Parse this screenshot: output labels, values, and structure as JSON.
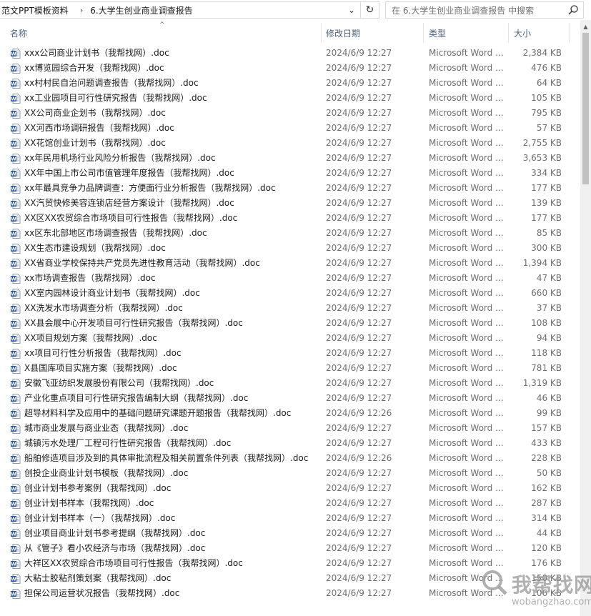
{
  "address": {
    "crumbs": [
      "范文PPT模板资料",
      "6.大学生创业商业调查报告"
    ],
    "separator": "›",
    "dropdown": "⌄",
    "refresh": "↻"
  },
  "search": {
    "placeholder": "在 6.大学生创业商业调查报告 中搜索"
  },
  "columns": {
    "name": "名称",
    "date": "修改日期",
    "type": "类型",
    "size": "大小",
    "sort_indicator": "^"
  },
  "scrollbar": {
    "up_arrow": "▲"
  },
  "watermark": {
    "text": "我帮找网",
    "url": "wobangzhao.com"
  },
  "icons": {
    "file": "word-doc-icon",
    "search": "search-icon"
  },
  "colors": {
    "header_text": "#4c607a",
    "word_blue": "#2b579a"
  },
  "files": [
    {
      "name": "xxx公司商业计划书（我帮找网）.doc",
      "date": "2024/6/9 12:27",
      "type": "Microsoft Word ...",
      "size": "2,384 KB"
    },
    {
      "name": "xx博览园综合开发（我帮找网）.doc",
      "date": "2024/6/9 12:27",
      "type": "Microsoft Word ...",
      "size": "476 KB"
    },
    {
      "name": "xx村村民自治问题调查报告（我帮找网）.doc",
      "date": "2024/6/9 12:27",
      "type": "Microsoft Word ...",
      "size": "64 KB"
    },
    {
      "name": "xx工业园项目可行性研究报告（我帮找网）.doc",
      "date": "2024/6/9 12:27",
      "type": "Microsoft Word ...",
      "size": "105 KB"
    },
    {
      "name": "XX公司商业企划书（我帮找网）.doc",
      "date": "2024/6/9 12:27",
      "type": "Microsoft Word ...",
      "size": "795 KB"
    },
    {
      "name": "XX河西市场调研报告（我帮找网）.doc",
      "date": "2024/6/9 12:27",
      "type": "Microsoft Word ...",
      "size": "57 KB"
    },
    {
      "name": "XX花馆创业计划书（我帮找网）.doc",
      "date": "2024/6/9 12:27",
      "type": "Microsoft Word ...",
      "size": "2,755 KB"
    },
    {
      "name": "xx年民用机场行业风险分析报告（我帮找网）.doc",
      "date": "2024/6/9 12:27",
      "type": "Microsoft Word ...",
      "size": "3,653 KB"
    },
    {
      "name": "XX年中国上市公司市值管理年度报告（我帮找网）.doc",
      "date": "2024/6/9 12:27",
      "type": "Microsoft Word ...",
      "size": "334 KB"
    },
    {
      "name": "xx年最具竞争力品牌调查：方便面行业分析报告（我帮找网）.doc",
      "date": "2024/6/9 12:27",
      "type": "Microsoft Word ...",
      "size": "177 KB"
    },
    {
      "name": "XX汽贸快修美容连锁店经营方案设计（我帮找网）.doc",
      "date": "2024/6/9 12:27",
      "type": "Microsoft Word ...",
      "size": "139 KB"
    },
    {
      "name": "XX区XX农贸综合市场项目可行性报告（我帮找网）.doc",
      "date": "2024/6/9 12:27",
      "type": "Microsoft Word ...",
      "size": "177 KB"
    },
    {
      "name": "xx区东北部地区市场调查报告（我帮找网）.doc",
      "date": "2024/6/9 12:27",
      "type": "Microsoft Word ...",
      "size": "85 KB"
    },
    {
      "name": "XX生态市建设规划（我帮找网）.doc",
      "date": "2024/6/9 12:27",
      "type": "Microsoft Word ...",
      "size": "300 KB"
    },
    {
      "name": "XX省商业学校保持共产党员先进性教育活动（我帮找网）.doc",
      "date": "2024/6/9 12:27",
      "type": "Microsoft Word ...",
      "size": "1,394 KB"
    },
    {
      "name": "xx市场调查报告（我帮找网）.doc",
      "date": "2024/6/9 12:27",
      "type": "Microsoft Word ...",
      "size": "47 KB"
    },
    {
      "name": "XX室内园林设计商业计划书（我帮找网）.doc",
      "date": "2024/6/9 12:27",
      "type": "Microsoft Word ...",
      "size": "660 KB"
    },
    {
      "name": "XX洗发水市场调查分析（我帮找网）.doc",
      "date": "2024/6/9 12:27",
      "type": "Microsoft Word ...",
      "size": "37 KB"
    },
    {
      "name": "XX县会展中心开发项目可行性研究报告（我帮找网）.doc",
      "date": "2024/6/9 12:27",
      "type": "Microsoft Word ...",
      "size": "108 KB"
    },
    {
      "name": "XX项目规划方案（我帮找网）.doc",
      "date": "2024/6/9 12:27",
      "type": "Microsoft Word ...",
      "size": "94 KB"
    },
    {
      "name": "xx项目可行性分析报告（我帮找网）.doc",
      "date": "2024/6/9 12:27",
      "type": "Microsoft Word ...",
      "size": "118 KB"
    },
    {
      "name": "X县国库项目实施方案（我帮找网）.doc",
      "date": "2024/6/9 12:27",
      "type": "Microsoft Word ...",
      "size": "781 KB"
    },
    {
      "name": "安徽飞亚纺织发展股份有限公司（我帮找网）.doc",
      "date": "2024/6/9 12:27",
      "type": "Microsoft Word ...",
      "size": "1,319 KB"
    },
    {
      "name": "产业化重点项目可行性研究报告编制大纲（我帮找网）.doc",
      "date": "2024/6/9 12:27",
      "type": "Microsoft Word ...",
      "size": "46 KB"
    },
    {
      "name": "超导材料科学及应用中的基础问题研究课题开题报告（我帮找网）.doc",
      "date": "2024/6/9 12:26",
      "type": "Microsoft Word ...",
      "size": "99 KB"
    },
    {
      "name": "城市商业发展与商业业态（我帮找网）.doc",
      "date": "2024/6/9 12:27",
      "type": "Microsoft Word ...",
      "size": "157 KB"
    },
    {
      "name": "城镇污水处理厂工程可行性研究报告（我帮找网）.doc",
      "date": "2024/6/9 12:27",
      "type": "Microsoft Word ...",
      "size": "433 KB"
    },
    {
      "name": "船舶修造项目涉及到的具体审批流程及相关前置条件列表（我帮找网）.doc",
      "date": "2024/6/9 12:26",
      "type": "Microsoft Word ...",
      "size": "228 KB"
    },
    {
      "name": "创投企业商业计划书模板（我帮找网）.doc",
      "date": "2024/6/9 12:27",
      "type": "Microsoft Word ...",
      "size": "50 KB"
    },
    {
      "name": "创业计划书参考案例（我帮找网）.doc",
      "date": "2024/6/9 12:27",
      "type": "Microsoft Word ...",
      "size": "162 KB"
    },
    {
      "name": "创业计划书样本（我帮找网）.doc",
      "date": "2024/6/9 12:27",
      "type": "Microsoft Word ...",
      "size": "287 KB"
    },
    {
      "name": "创业计划书样本（一）（我帮找网）.doc",
      "date": "2024/6/9 12:27",
      "type": "Microsoft Word ...",
      "size": "314 KB"
    },
    {
      "name": "创业项目商业计划书参考提纲（我帮找网）.doc",
      "date": "2024/6/9 12:27",
      "type": "Microsoft Word ...",
      "size": "44 KB"
    },
    {
      "name": "从《管子》看小农经济与市场（我帮找网）.doc",
      "date": "2024/6/9 12:27",
      "type": "Microsoft Word ...",
      "size": "120 KB"
    },
    {
      "name": "大祥区XX农贸综合市场项目可行性报告（我帮找网）.doc",
      "date": "2024/6/9 12:27",
      "type": "Microsoft Word ...",
      "size": "176 KB"
    },
    {
      "name": "大粘士胶粘剂策划案（我帮找网）.doc",
      "date": "2024/6/9 12:27",
      "type": "Microsoft Word ...",
      "size": "150 KB"
    },
    {
      "name": "担保公司运营状况报告（我帮找网）.doc",
      "date": "2024/6/9 12:27",
      "type": "Microsoft Word ...",
      "size": "106 KB"
    }
  ]
}
